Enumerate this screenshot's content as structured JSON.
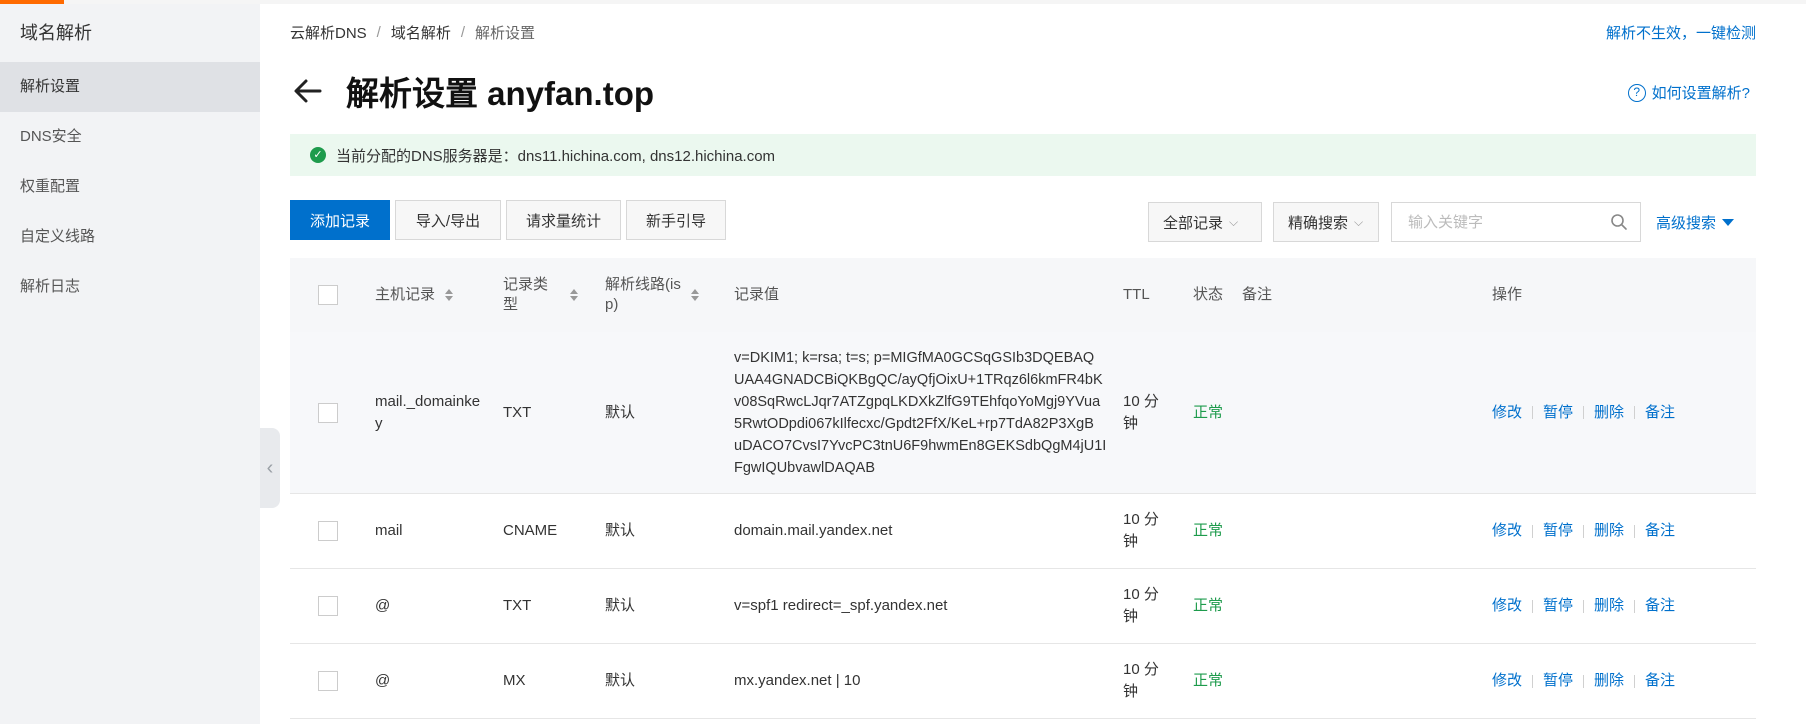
{
  "sidebar": {
    "title": "域名解析",
    "items": [
      {
        "label": "解析设置",
        "active": true
      },
      {
        "label": "DNS安全"
      },
      {
        "label": "权重配置"
      },
      {
        "label": "自定义线路"
      },
      {
        "label": "解析日志"
      }
    ],
    "collapse_glyph": "‹"
  },
  "breadcrumb": {
    "items": [
      "云解析DNS",
      "域名解析",
      "解析设置"
    ],
    "sep": "/"
  },
  "top_link": "解析不生效，一键检测",
  "page_title": "解析设置 anyfan.top",
  "help": {
    "icon": "?",
    "label": "如何设置解析?"
  },
  "notice": {
    "icon": "✓",
    "text": "当前分配的DNS服务器是：dns11.hichina.com, dns12.hichina.com"
  },
  "toolbar": {
    "add": "添加记录",
    "import_export": "导入/导出",
    "stats": "请求量统计",
    "guide": "新手引导",
    "filter_all": "全部记录",
    "filter_chevron": "⌵",
    "match_mode": "精确搜索",
    "search_placeholder": "输入关键字",
    "advanced": "高级搜索"
  },
  "table": {
    "headers": {
      "host": "主机记录",
      "type_1": "记录类",
      "type_2": "型",
      "line_1": "解析线路(is",
      "line_2": "p)",
      "value": "记录值",
      "ttl": "TTL",
      "status": "状态",
      "remark": "备注",
      "ops": "操作"
    },
    "rows": [
      {
        "host_1": "mail._domainke",
        "host_2": "y",
        "type": "TXT",
        "line": "默认",
        "value_lines": [
          "v=DKIM1; k=rsa; t=s; p=MIGfMA0GCSqGSIb3DQEBAQ",
          "UAA4GNADCBiQKBgQC/ayQfjOixU+1TRqz6l6kmFR4bK",
          "v08SqRwcLJqr7ATZgpqLKDXkZlfG9TEhfqoYoMgj9YVua",
          "5RwtODpdi067kIlfecxc/Gpdt2FfX/KeL+rp7TdA82P3XgB",
          "uDACO7CvsI7YvcPC3tnU6F9hwmEn8GEKSdbQgM4jU1I",
          "FgwIQUbvawlDAQAB"
        ],
        "ttl_1": "10 分",
        "ttl_2": "钟",
        "status": "正常",
        "ops": [
          "修改",
          "暂停",
          "删除",
          "备注"
        ]
      },
      {
        "host_1": "mail",
        "host_2": "",
        "type": "CNAME",
        "line": "默认",
        "value_lines": [
          "domain.mail.yandex.net"
        ],
        "ttl_1": "10 分",
        "ttl_2": "钟",
        "status": "正常",
        "ops": [
          "修改",
          "暂停",
          "删除",
          "备注"
        ]
      },
      {
        "host_1": "@",
        "host_2": "",
        "type": "TXT",
        "line": "默认",
        "value_lines": [
          "v=spf1 redirect=_spf.yandex.net"
        ],
        "ttl_1": "10 分",
        "ttl_2": "钟",
        "status": "正常",
        "ops": [
          "修改",
          "暂停",
          "删除",
          "备注"
        ]
      },
      {
        "host_1": "@",
        "host_2": "",
        "type": "MX",
        "line": "默认",
        "value_lines": [
          "mx.yandex.net | 10"
        ],
        "ttl_1": "10 分",
        "ttl_2": "钟",
        "status": "正常",
        "ops": [
          "修改",
          "暂停",
          "删除",
          "备注"
        ]
      }
    ]
  }
}
